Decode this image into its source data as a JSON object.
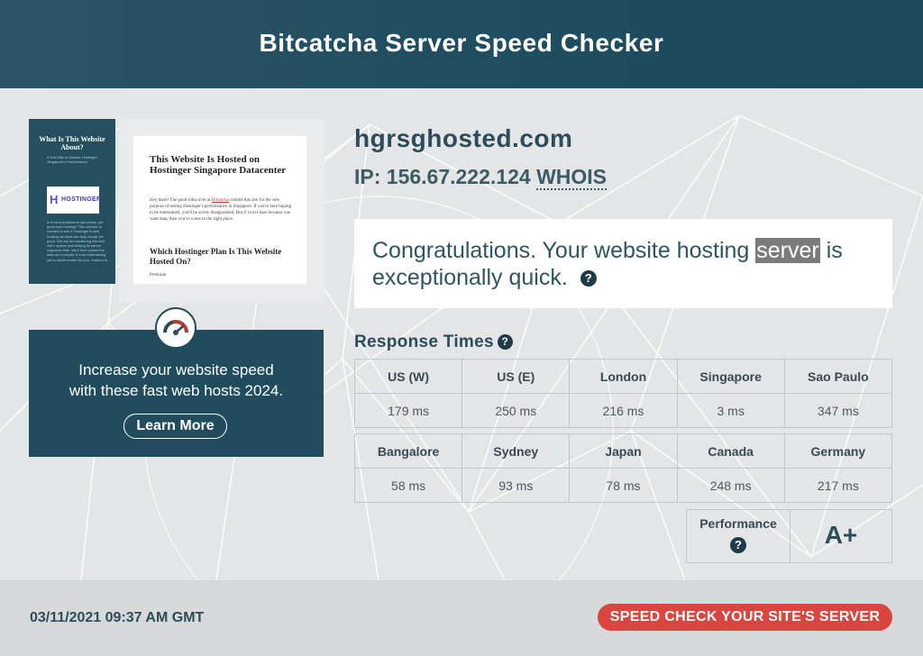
{
  "header": {
    "title": "Bitcatcha Server Speed Checker"
  },
  "preview": {
    "sidebar_title": "What Is This Website About?",
    "sidebar_subtitle": "A Test Site to Monitor Hostinger Singapore's Performance",
    "logo_text": "HOSTINGER",
    "sidebar_text": "Is it even possible to get cheap, yet good web hosting? This website is created to see if Hostinger's web hosting services are truly cheap yet good. We will be monitoring this test site's uptime and testing its server response time. We'll then collect the data and compile it in an entertaining yet in-depth review for you, readers to",
    "page_title": "This Website Is Hosted on Hostinger Singapore Datacenter",
    "page_text_before_link": "Hey there! The good folks over at ",
    "page_link": "Bitcatcha",
    "page_text_after_link": " created this site for the sole purpose of testing Hostinger's performance in Singapore. If you're here hoping to be entertained, you'll be sorely disappointed. But if you're here because you want data, then you've come to the right place.",
    "page_heading2": "Which Hostinger Plan Is This Website Hosted On?",
    "page_small": "Premium"
  },
  "promo": {
    "text_line1": "Increase your website speed",
    "text_line2": "with these fast web hosts 2024.",
    "button_label": "Learn More"
  },
  "site": {
    "domain": "hgrsghosted.com",
    "ip_label": "IP: 156.67.222.124",
    "whois_label": "WHOIS"
  },
  "result": {
    "text_part1": "Congratulations. Your website hosting ",
    "highlight": "server",
    "text_part2": " is exceptionally quick.",
    "help_glyph": "?"
  },
  "response_times": {
    "title": "Response Times",
    "help_glyph": "?",
    "row1": [
      {
        "location": "US (W)",
        "time": "179 ms"
      },
      {
        "location": "US (E)",
        "time": "250 ms"
      },
      {
        "location": "London",
        "time": "216 ms"
      },
      {
        "location": "Singapore",
        "time": "3 ms"
      },
      {
        "location": "Sao Paulo",
        "time": "347 ms"
      }
    ],
    "row2": [
      {
        "location": "Bangalore",
        "time": "58 ms"
      },
      {
        "location": "Sydney",
        "time": "93 ms"
      },
      {
        "location": "Japan",
        "time": "78 ms"
      },
      {
        "location": "Canada",
        "time": "248 ms"
      },
      {
        "location": "Germany",
        "time": "217 ms"
      }
    ]
  },
  "performance": {
    "label": "Performance",
    "help_glyph": "?",
    "grade": "A+"
  },
  "footer": {
    "timestamp": "03/11/2021 09:37 AM GMT",
    "cta_label": "SPEED CHECK YOUR SITE'S SERVER"
  },
  "colors": {
    "header_bg": "#1f4e60",
    "promo_bg": "#214c5d",
    "cta_bg": "#d9463f",
    "heading_text": "#2d4c5a",
    "highlight_bg": "#7b7b7b"
  },
  "icons": [
    "speed-gauge-icon",
    "help-icon",
    "hostinger-logo"
  ]
}
